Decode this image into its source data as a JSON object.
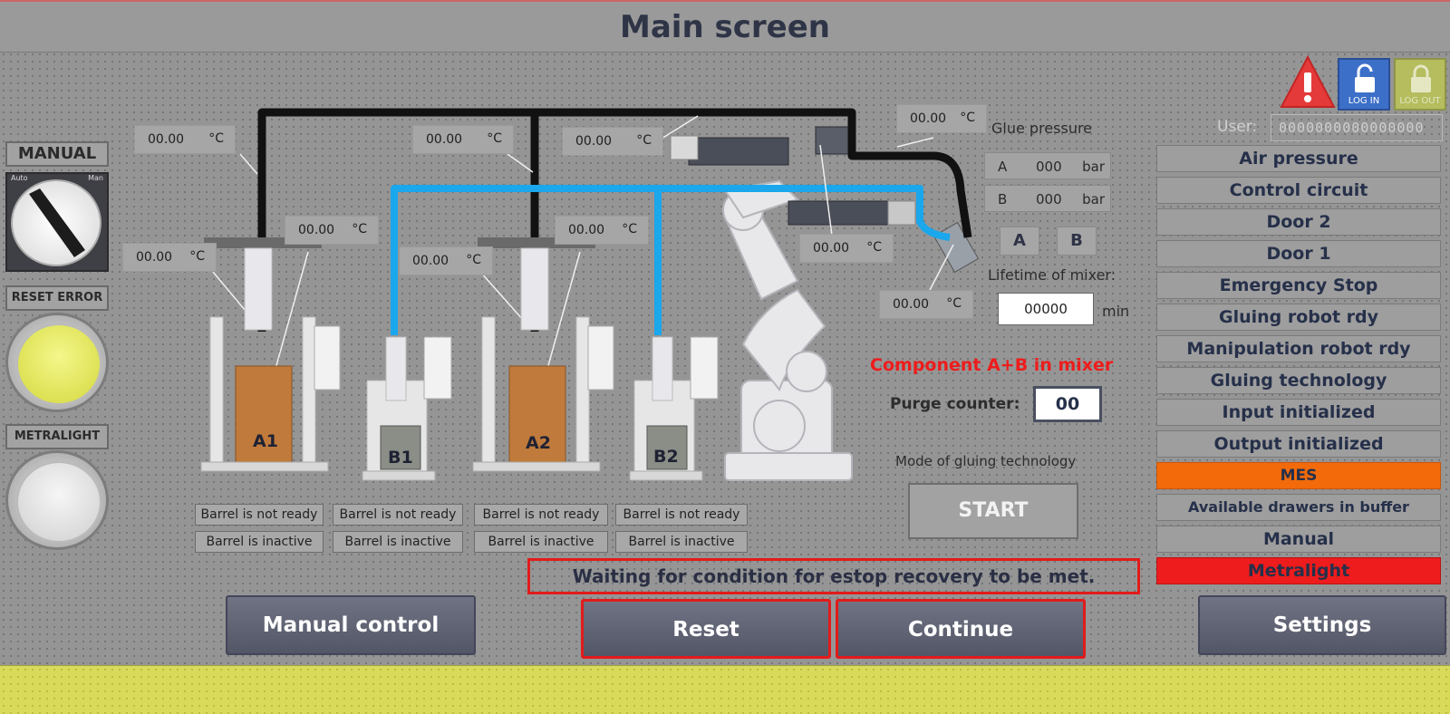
{
  "title": "Main screen",
  "colors": {
    "accent_blue": "#1aa7ec",
    "pipe_black": "#111111",
    "alarm_red": "#e21b1b",
    "mes_orange": "#f26a0a",
    "metralight_red": "#ee1c1c",
    "footer_yellow": "#d9d95a",
    "lamp_yellow": "#e8ec6a"
  },
  "top_right": {
    "warning_icon": "warning-triangle-icon",
    "login_label": "LOG IN",
    "logout_label": "LOG OUT",
    "user_label": "User:",
    "user_value": "0000000000000000"
  },
  "left_panel": {
    "manual_label": "MANUAL",
    "switch_left": "Auto",
    "switch_right": "Man",
    "reset_error_label": "RESET ERROR",
    "metralight_label": "METRALIGHT"
  },
  "unit_c": "°C",
  "temperatures": {
    "t1": "00.00",
    "t2": "00.00",
    "t3": "00.00",
    "t4": "00.00",
    "t5": "00.00",
    "t6": "00.00",
    "t7": "00.00",
    "t8": "00.00",
    "t9": "00.00",
    "t10": "00.00"
  },
  "barrels": [
    {
      "label": "A1",
      "ready": "Barrel is not ready",
      "active": "Barrel is inactive"
    },
    {
      "label": "B1",
      "ready": "Barrel is not ready",
      "active": "Barrel is inactive"
    },
    {
      "label": "A2",
      "ready": "Barrel is not ready",
      "active": "Barrel is inactive"
    },
    {
      "label": "B2",
      "ready": "Barrel is not ready",
      "active": "Barrel is inactive"
    }
  ],
  "glue": {
    "pressure_label": "Glue pressure",
    "a_label": "A",
    "a_value": "000",
    "b_label": "B",
    "b_value": "000",
    "unit_bar": "bar",
    "btn_a": "A",
    "btn_b": "B",
    "lifetime_label": "Lifetime of mixer:",
    "lifetime_value": "00000",
    "lifetime_unit": "min",
    "component_msg": "Component A+B in mixer",
    "purge_label": "Purge counter:",
    "purge_value": "00",
    "mode_label": "Mode of gluing technology",
    "start_label": "START"
  },
  "status_list": [
    {
      "label": "Air pressure"
    },
    {
      "label": "Control circuit"
    },
    {
      "label": "Door 2"
    },
    {
      "label": "Door 1"
    },
    {
      "label": "Emergency Stop"
    },
    {
      "label": "Gluing robot rdy"
    },
    {
      "label": "Manipulation robot rdy"
    },
    {
      "label": "Gluing technology"
    },
    {
      "label": "Input initialized"
    },
    {
      "label": "Output initialized"
    },
    {
      "label": "MES"
    },
    {
      "label": "Available drawers in buffer"
    },
    {
      "label": "Manual"
    },
    {
      "label": "Metralight"
    }
  ],
  "message": "Waiting for condition for estop recovery to be met.",
  "buttons": {
    "manual_control": "Manual control",
    "reset": "Reset",
    "continue": "Continue",
    "settings": "Settings"
  }
}
